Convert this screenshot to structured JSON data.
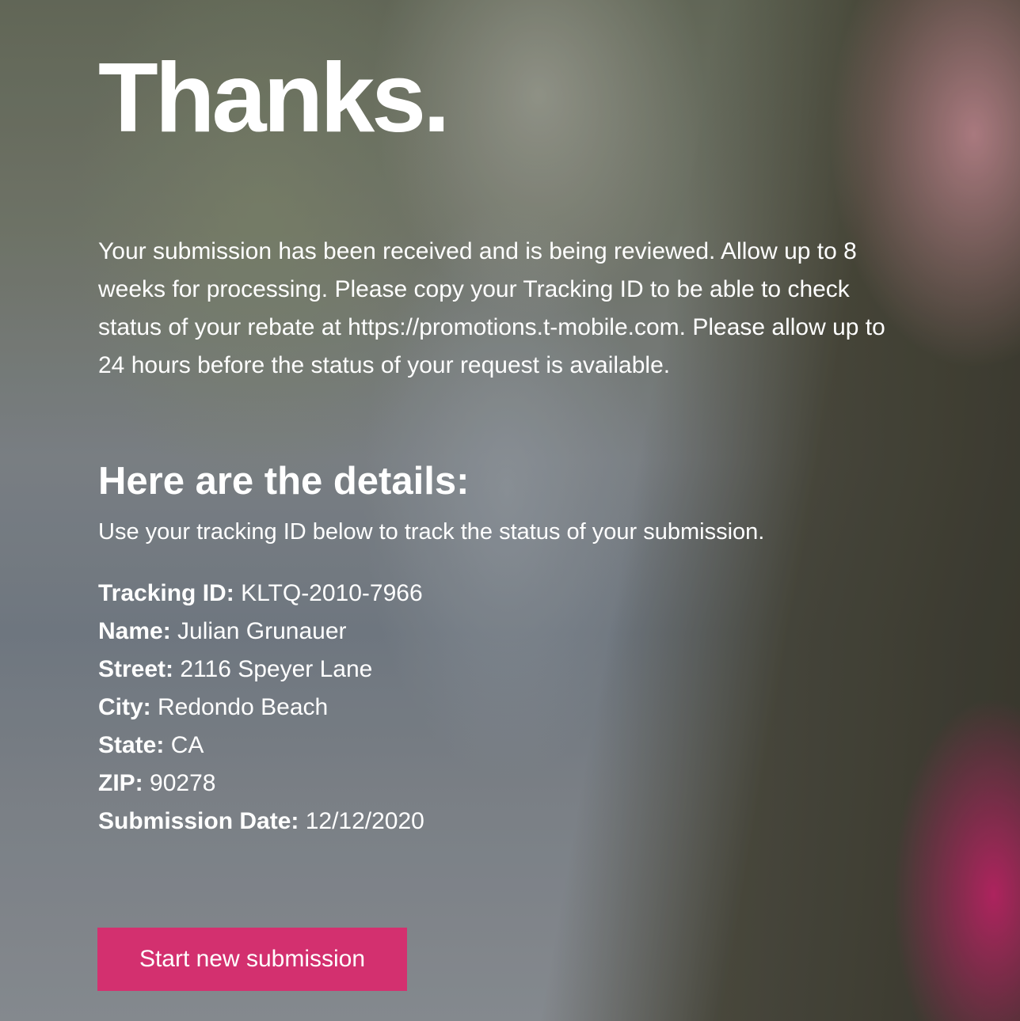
{
  "header": {
    "title": "Thanks."
  },
  "intro": {
    "text": "Your submission has been received and is being reviewed. Allow up to 8 weeks for processing. Please copy your Tracking ID to be able to check status of your rebate at https://promotions.t-mobile.com. Please allow up to 24 hours before the status of your request is available."
  },
  "details": {
    "heading": "Here are the details:",
    "subtext": "Use your tracking ID below to track the status of your submission.",
    "fields": [
      {
        "label": "Tracking ID:",
        "value": "KLTQ-2010-7966"
      },
      {
        "label": "Name:",
        "value": "Julian Grunauer"
      },
      {
        "label": "Street:",
        "value": "2116 Speyer Lane"
      },
      {
        "label": "City:",
        "value": "Redondo Beach"
      },
      {
        "label": "State:",
        "value": "CA"
      },
      {
        "label": "ZIP:",
        "value": "90278"
      },
      {
        "label": "Submission Date:",
        "value": "12/12/2020"
      }
    ]
  },
  "actions": {
    "new_submission_label": "Start new submission"
  },
  "colors": {
    "button_background": "#d3306f",
    "text": "#ffffff"
  }
}
